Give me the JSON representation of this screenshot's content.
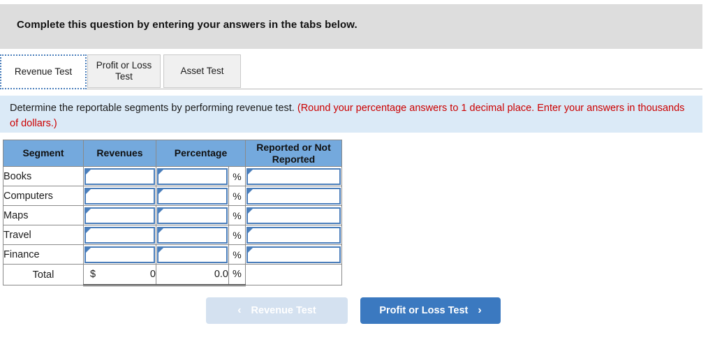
{
  "banner": {
    "text": "Complete this question by entering your answers in the tabs below."
  },
  "tabs": {
    "items": [
      {
        "label": "Revenue Test",
        "active": true
      },
      {
        "label": "Profit or Loss Test",
        "active": false
      },
      {
        "label": "Asset Test",
        "active": false
      }
    ]
  },
  "instruction": {
    "main": "Determine the reportable segments by performing revenue test.",
    "hint": "(Round your percentage answers to 1 decimal place. Enter your answers in thousands of dollars.)"
  },
  "table": {
    "headers": [
      "Segment",
      "Revenues",
      "Percentage",
      "",
      "Reported or Not Reported"
    ],
    "rows": [
      {
        "segment": "Books",
        "revenues": "",
        "percentage": "",
        "percent_sign": "%",
        "reported": ""
      },
      {
        "segment": "Computers",
        "revenues": "",
        "percentage": "",
        "percent_sign": "%",
        "reported": ""
      },
      {
        "segment": "Maps",
        "revenues": "",
        "percentage": "",
        "percent_sign": "%",
        "reported": ""
      },
      {
        "segment": "Travel",
        "revenues": "",
        "percentage": "",
        "percent_sign": "%",
        "reported": ""
      },
      {
        "segment": "Finance",
        "revenues": "",
        "percentage": "",
        "percent_sign": "%",
        "reported": ""
      }
    ],
    "total": {
      "label": "Total",
      "currency_symbol": "$",
      "revenues": "0",
      "percentage": "0.0",
      "percent_sign": "%",
      "reported": ""
    }
  },
  "footer": {
    "prev_label": "Revenue Test",
    "prev_icon": "chevron-left-icon",
    "prev_disabled": true,
    "next_label": "Profit or Loss Test",
    "next_icon": "chevron-right-icon",
    "prev_chevron": "‹",
    "next_chevron": "›"
  },
  "colors": {
    "banner_bg": "#dddddd",
    "instruction_bg": "#dbeaf7",
    "hint_text": "#cc0000",
    "table_header_bg": "#74a9dd",
    "input_border": "#4a7ebb",
    "primary_button": "#3b79c0",
    "disabled_button": "#d4e1f0"
  }
}
